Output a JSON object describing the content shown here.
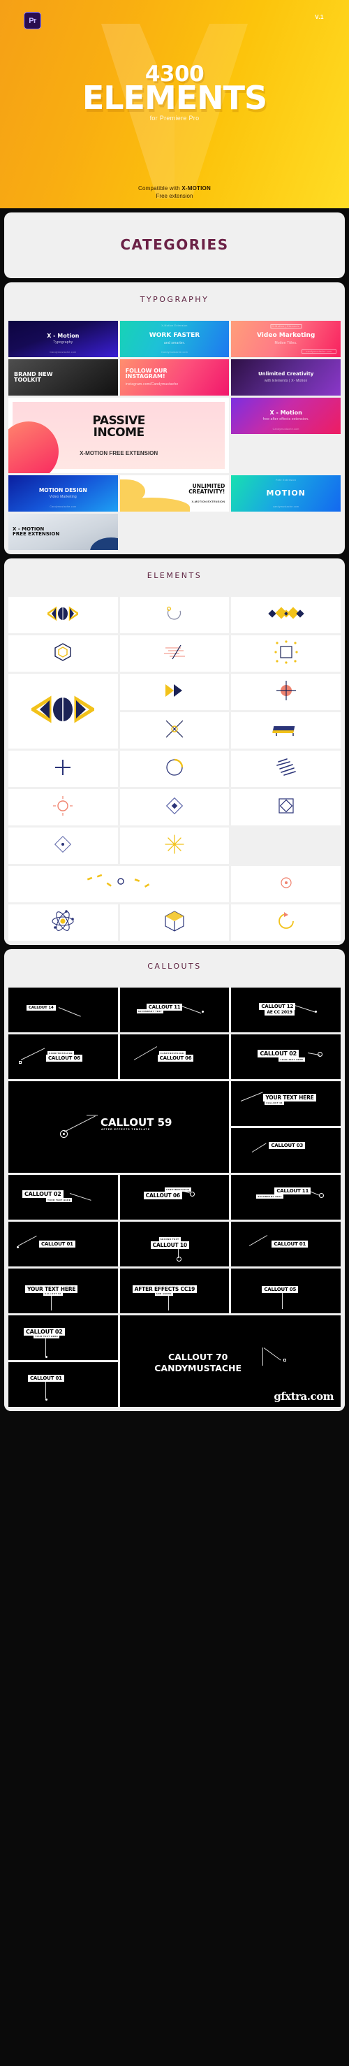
{
  "hero": {
    "app_badge": "Pr",
    "version": "V.1",
    "count": "4300",
    "title": "ELEMENTS",
    "subtitle": "for Premiere Pro",
    "compatible_prefix": "Compatible with ",
    "compatible_brand": "X-MOTION",
    "compatible_line2": "Free extension",
    "bg_start": "#f5a016",
    "bg_end": "#ffdd25"
  },
  "categories": {
    "heading": "CATEGORIES",
    "accent": "#6b2146"
  },
  "typography": {
    "heading": "TYPOGRAPHY",
    "tiles": [
      {
        "title": "X - Motion",
        "sub": "Typography",
        "micro": "Candymustache.com",
        "tag": ""
      },
      {
        "title": "WORK FASTER",
        "sub": "and smarter.",
        "micro": "Candymustache.com",
        "tag": "X-Motion Extension"
      },
      {
        "title": "Video Marketing",
        "sub": "Motion Titles.",
        "micro": "candymustache.com",
        "tag": "X-Motion | Elements"
      },
      {
        "title": "BRAND NEW\nTOOLKIT",
        "sub": "",
        "micro": "",
        "tag": ""
      },
      {
        "title": "FOLLOW OUR\nINSTAGRAM!",
        "sub": "instagram.com/Candymustache",
        "micro": "",
        "tag": ""
      },
      {
        "title": "Unlimited Creativity",
        "sub": "with Elements | X- Motion",
        "micro": "",
        "tag": ""
      },
      {
        "title": "PASSIVE\nINCOME",
        "sub": "X-MOTION FREE EXTENSION",
        "micro": "",
        "tag": ""
      },
      {
        "title": "X - Motion",
        "sub": "free after effects extension.",
        "micro": "Candymustache.com",
        "tag": ""
      },
      {
        "title": "MOTION DESIGN",
        "sub": "Video Marketing",
        "micro": "Candymustache.com",
        "tag": ""
      },
      {
        "title": "UNLIMITED\nCREATIVITY!",
        "sub": "X-MOTION EXTENSION",
        "micro": "",
        "tag": ""
      },
      {
        "title": "MOTION",
        "sub": "",
        "micro": "candymustache.com",
        "tag": "Free Extension"
      },
      {
        "title": "X - MOTION\nFREE EXTENSION",
        "sub": "",
        "micro": "",
        "tag": ""
      }
    ]
  },
  "elements": {
    "heading": "ELEMENTS",
    "icons": [
      "eye-diamond-icon",
      "circle-spinner-icon",
      "diamond-cluster-icon",
      "hexagon-outline-icon",
      "speed-lines-icon",
      "dotted-starburst-icon",
      "eye-diamond-large-icon",
      "chevron-arrow-icon",
      "crosshair-circle-icon",
      "sparkle-cross-icon",
      "flag-banner-icon",
      "plus-cross-icon",
      "circle-arc-icon",
      "scribble-lines-icon",
      "sun-burst-icon",
      "diamond-small-icon",
      "diamond-square-icon",
      "diamond-thin-icon",
      "star-flare-icon",
      "dotted-trail-icon",
      "circle-dot-icon",
      "atom-orbit-icon",
      "cube-outline-icon",
      "swirl-arrow-icon"
    ]
  },
  "callouts": {
    "heading": "CALLOUTS",
    "items": [
      {
        "label": "CALLOUT 14",
        "sub": ""
      },
      {
        "label": "CALLOUT 11",
        "sub": "SECONDARY TEXT"
      },
      {
        "label": "CALLOUT 12",
        "sub": "AE CC 2019"
      },
      {
        "label": "CALLOUT 06",
        "sub": "CANDYMUSTACHE"
      },
      {
        "label": "CALLOUT 06",
        "sub": "CANDYMUSTACHE"
      },
      {
        "label": "CALLOUT 02",
        "sub": "YOUR TEXT HERE"
      },
      {
        "label": "CALLOUT 59",
        "sub": "AFTER EFFECTS TEMPLATE"
      },
      {
        "label": "YOUR TEXT HERE",
        "sub": "CALLOUT 03"
      },
      {
        "label": "CALLOUT 03",
        "sub": ""
      },
      {
        "label": "CALLOUT 02",
        "sub": "YOUR TEXT HERE"
      },
      {
        "label": "CALLOUT 06",
        "sub": "CANDYMUSTACHE"
      },
      {
        "label": "CALLOUT 11",
        "sub": "SECONDARY TEXT"
      },
      {
        "label": "CALLOUT 01",
        "sub": ""
      },
      {
        "label": "CALLOUT 10",
        "sub": "SECOND TEXT"
      },
      {
        "label": "CALLOUT 01",
        "sub": ""
      },
      {
        "label": "YOUR TEXT HERE",
        "sub": "CALLOUT 02"
      },
      {
        "label": "AFTER EFFECTS CC19",
        "sub": "AND ABOVE"
      },
      {
        "label": "CALLOUT 05",
        "sub": ""
      },
      {
        "label": "CALLOUT 02",
        "sub": "YOUR TEXT HERE"
      },
      {
        "label": "CALLOUT 70\nCANDYMUSTACHE",
        "sub": ""
      },
      {
        "label": "CALLOUT 01",
        "sub": ""
      }
    ]
  },
  "watermark": "gfxtra.com"
}
